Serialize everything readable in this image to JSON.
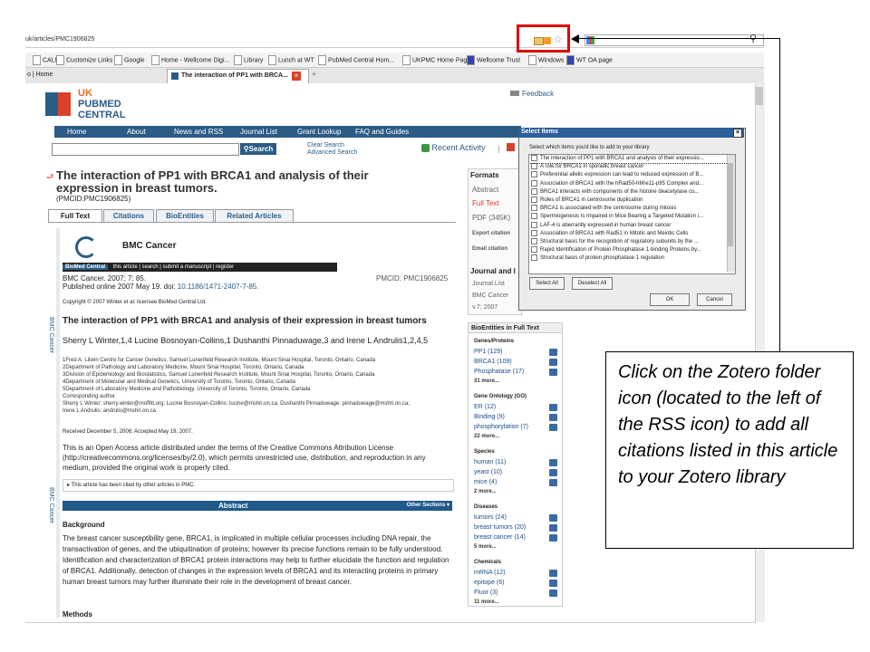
{
  "browser": {
    "address": "uk/articles/PMC1906825",
    "bookmarks": [
      "CALM",
      "Customize Links",
      "Google",
      "Home - Wellcome Digi...",
      "Library",
      "Lunch at WT",
      "PubMed Central Hom...",
      "UKPMC Home Page",
      "Wellcome Trust",
      "Windows",
      "WT OA page"
    ],
    "tab_left": "o | Home",
    "tab_active": "The interaction of PP1 with BRCA..."
  },
  "site": {
    "logo": [
      "UK",
      "PUBMED",
      "CENTRAL"
    ],
    "feedback": "Feedback",
    "nav": [
      "Home",
      "About",
      "News and RSS",
      "Journal List",
      "Grant Lookup",
      "FAQ and Guides"
    ],
    "search_button": "Search",
    "clear_search": "Clear Search",
    "advanced_search": "Advanced Search",
    "recent_activity": "Recent Activity"
  },
  "article": {
    "title": "The interaction of PP1 with BRCA1 and analysis of their expression in breast tumors.",
    "pmcid_line": "(PMCID:PMC1906825)",
    "tabs": [
      "Full Text",
      "Citations",
      "BioEntities",
      "Related Articles"
    ],
    "journal": "BMC Cancer",
    "journal_bar": [
      "BioMed Central",
      "this article",
      "search",
      "submit a manuscript",
      "register"
    ],
    "citation": "BMC Cancer. 2007; 7: 85.",
    "published": "Published online 2007 May 19. doi: ",
    "doi": "10.1186/1471-2407-7-85.",
    "pmcid": "PMCID: PMC1906825",
    "copyright": "Copyright © 2007 Winter et al; licensee BioMed Central Ltd.",
    "heading": "The interaction of PP1 with BRCA1 and analysis of their expression in breast tumors",
    "authors": "Sherry L Winter,1,4 Lucine Bosnoyan-Collins,1 Dushanthi Pinnaduwage,3 and Irene L Andrulis1,2,4,5",
    "affiliations": [
      "1Fred A. Litwin Centre for Cancer Genetics, Samuel Lunenfeld Research Institute, Mount Sinai Hospital, Toronto, Ontario, Canada",
      "2Department of Pathology and Laboratory Medicine, Mount Sinai Hospital, Toronto, Ontario, Canada",
      "3Division of Epidemiology and Biostatistics, Samuel Lunenfeld Research Institute, Mount Sinai Hospital, Toronto, Ontario, Canada",
      "4Department of Molecular and Medical Genetics, University of Toronto, Toronto, Ontario, Canada",
      "5Department of Laboratory Medicine and Pathobiology, University of Toronto, Toronto, Ontario, Canada",
      "Corresponding author.",
      "Sherry L Winter: sherry.winter@moffitt.org; Lucine Bosnoyan-Collins: lucine@mshri.on.ca; Dushanthi Pinnaduwage: pinnaduwage@mshri.on.ca;",
      "Irene L Andrulis: andrulis@mshri.on.ca"
    ],
    "received": "Received December 5, 2006; Accepted May 19, 2007.",
    "license": "This is an Open Access article distributed under the terms of the Creative Commons Attribution License (http://creativecommons.org/licenses/by/2.0), which permits unrestricted use, distribution, and reproduction in any medium, provided the original work is properly cited.",
    "cited": "This article has been cited by other articles in PMC.",
    "abstract_bar": "Abstract",
    "other_sections": "Other Sections",
    "background_head": "Background",
    "background": "The breast cancer susceptibility gene, BRCA1, is implicated in multiple cellular processes including DNA repair, the transactivation of genes, and the ubiquitination of proteins; however its precise functions remain to be fully understood. Identification and characterization of BRCA1 protein interactions may help to further elucidate the function and regulation of BRCA1. Additionally, detection of changes in the expression levels of BRCA1 and its interacting proteins in primary human breast tumors may further illuminate their role in the development of breast cancer.",
    "methods_head": "Methods",
    "side_label": "BMC Cancer"
  },
  "formats": {
    "head": "Formats",
    "items": [
      "Abstract",
      "Full Text",
      "PDF (345K)",
      "Export citation",
      "Email citation"
    ],
    "journal_head": "Journal and I",
    "journal_items": [
      "Journal List",
      "BMC Cancer",
      "v.7; 2007"
    ]
  },
  "bioentities": {
    "head": "BioEntities in Full Text",
    "groups": [
      {
        "name": "Genes/Proteins",
        "items": [
          "PP1 (129)",
          "BRCA1 (109)",
          "Phosphatase (17)"
        ],
        "more": "31 more..."
      },
      {
        "name": "Gene Ontology (GO)",
        "items": [
          "ER (12)",
          "Binding (9)",
          "phosphorylation (7)"
        ],
        "more": "22 more..."
      },
      {
        "name": "Species",
        "items": [
          "human (11)",
          "yeast (10)",
          "mice (4)"
        ],
        "more": "2 more..."
      },
      {
        "name": "Diseases",
        "items": [
          "tumors (24)",
          "breast tumors (20)",
          "breast cancer (14)"
        ],
        "more": "5 more..."
      },
      {
        "name": "Chemicals",
        "items": [
          "mRNA (12)",
          "epitope (6)",
          "Fluor (3)"
        ],
        "more": "11 more..."
      }
    ]
  },
  "dialog": {
    "title": "Select Items",
    "prompt": "Select which items you'd like to add to your library",
    "items": [
      "The interaction of PP1 with BRCA1 and analysis of their expressio...",
      "A role for BRCA1 in sporadic breast cancer",
      "Preferential allelic expression can lead to reduced expression of B...",
      "Association of BRCA1 with the hRad50-hMre11-p95 Complex and...",
      "BRCA1 interacts with components of the histone deacetylase co...",
      "Roles of BRCA1 in centrosome duplication",
      "BRCA1 is associated with the centrosome during mitosis",
      "Spermiogenesis Is Impaired in Mice Bearing a Targeted Mutation i...",
      "LAF-4 is aberrantly expressed in human breast cancer",
      "Association of BRCA1 with Rad51 in Mitotic and Meiotic Cells",
      "Structural basis for the recognition of regulatory subunits by the ...",
      "Rapid Identification of Protein Phosphatase 1-binding Proteins by...",
      "Structural basis of protein phosphatase 1 regulation"
    ],
    "select_all": "Select All",
    "deselect_all": "Deselect All",
    "ok": "OK",
    "cancel": "Cancel"
  },
  "callout": {
    "text": "Click on the Zotero folder icon (located to the left of the RSS icon) to add all citations listed in this article to your Zotero library"
  },
  "colors": {
    "highlight": "#e00000",
    "nav": "#2b5c86",
    "dialog_title": "#2d5f9a",
    "bar": "#1f5a8a"
  }
}
